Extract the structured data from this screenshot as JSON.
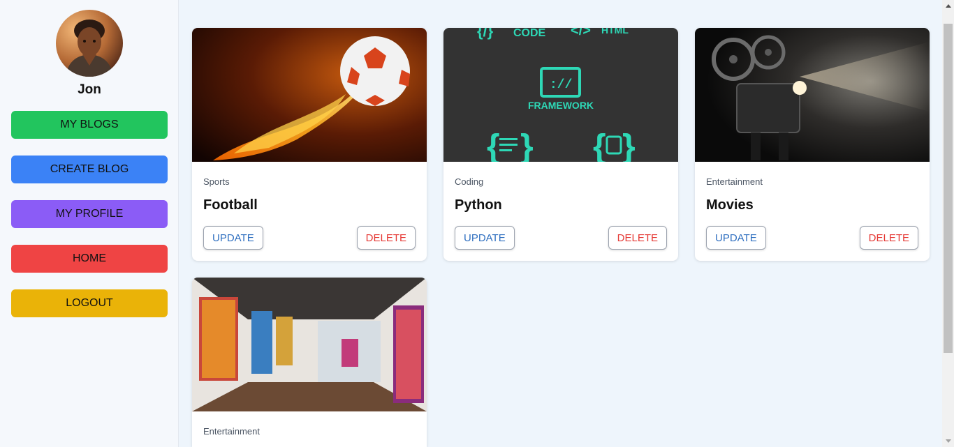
{
  "user": {
    "name": "Jon"
  },
  "nav": [
    {
      "label": "MY BLOGS"
    },
    {
      "label": "CREATE BLOG"
    },
    {
      "label": "MY PROFILE"
    },
    {
      "label": "HOME"
    },
    {
      "label": "LOGOUT"
    }
  ],
  "cards": [
    {
      "category": "Sports",
      "title": "Football",
      "update_label": "UPDATE",
      "delete_label": "DELETE"
    },
    {
      "category": "Coding",
      "title": "Python",
      "update_label": "UPDATE",
      "delete_label": "DELETE",
      "image_text": {
        "code": "CODE",
        "html": "HTML",
        "framework": "FRAMEWORK"
      }
    },
    {
      "category": "Entertainment",
      "title": "Movies",
      "update_label": "UPDATE",
      "delete_label": "DELETE"
    },
    {
      "category": "Entertainment"
    }
  ],
  "colors": {
    "my_blogs": "#22c55e",
    "create_blog": "#3b82f6",
    "my_profile": "#8b5cf6",
    "home": "#ef4444",
    "logout": "#eab308",
    "update_text": "#2f6fc0",
    "delete_text": "#e53935"
  }
}
